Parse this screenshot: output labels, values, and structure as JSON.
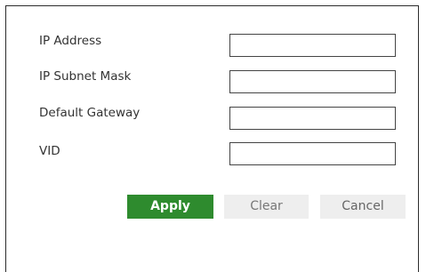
{
  "form": {
    "fields": [
      {
        "label": "IP Address",
        "value": "",
        "placeholder": ""
      },
      {
        "label": "IP Subnet Mask",
        "value": "",
        "placeholder": ""
      },
      {
        "label": "Default Gateway",
        "value": "",
        "placeholder": ""
      },
      {
        "label": "VID",
        "value": "",
        "placeholder": ""
      }
    ]
  },
  "buttons": {
    "apply_label": "Apply",
    "clear_label": "Clear",
    "cancel_label": "Cancel"
  },
  "colors": {
    "apply_bg": "#2e8b2e",
    "secondary_bg": "#eeeeee",
    "border": "#444444"
  }
}
